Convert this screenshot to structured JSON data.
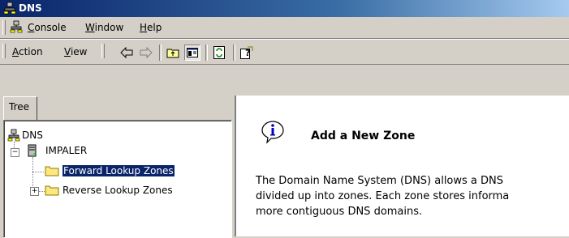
{
  "window": {
    "title": "DNS"
  },
  "menubar": {
    "items": [
      {
        "label": "Console",
        "mnemonic": "C",
        "rest": "onsole"
      },
      {
        "label": "Window",
        "mnemonic": "W",
        "rest": "indow"
      },
      {
        "label": "Help",
        "mnemonic": "H",
        "rest": "elp"
      }
    ]
  },
  "toolbar": {
    "action": {
      "label": "Action",
      "mnemonic": "A",
      "rest": "ction"
    },
    "view": {
      "label": "View",
      "mnemonic": "V",
      "rest": "iew"
    },
    "buttons": [
      "back-icon",
      "forward-icon",
      "up-one-level-icon",
      "show-hide-tree-icon",
      "refresh-icon",
      "help-icon"
    ]
  },
  "tree": {
    "tab_label": "Tree",
    "root": "DNS",
    "server": "IMPALER",
    "zones": [
      "Forward Lookup Zones",
      "Reverse Lookup Zones"
    ],
    "selected": "Forward Lookup Zones"
  },
  "details": {
    "title": "Add a New Zone",
    "lines": [
      "The Domain Name System (DNS) allows a DNS",
      "divided up into zones. Each zone stores informa",
      "more contiguous DNS domains."
    ]
  },
  "colors": {
    "title_active": "#0a246a",
    "face": "#d4d0c8",
    "selection": "#0a246a"
  }
}
